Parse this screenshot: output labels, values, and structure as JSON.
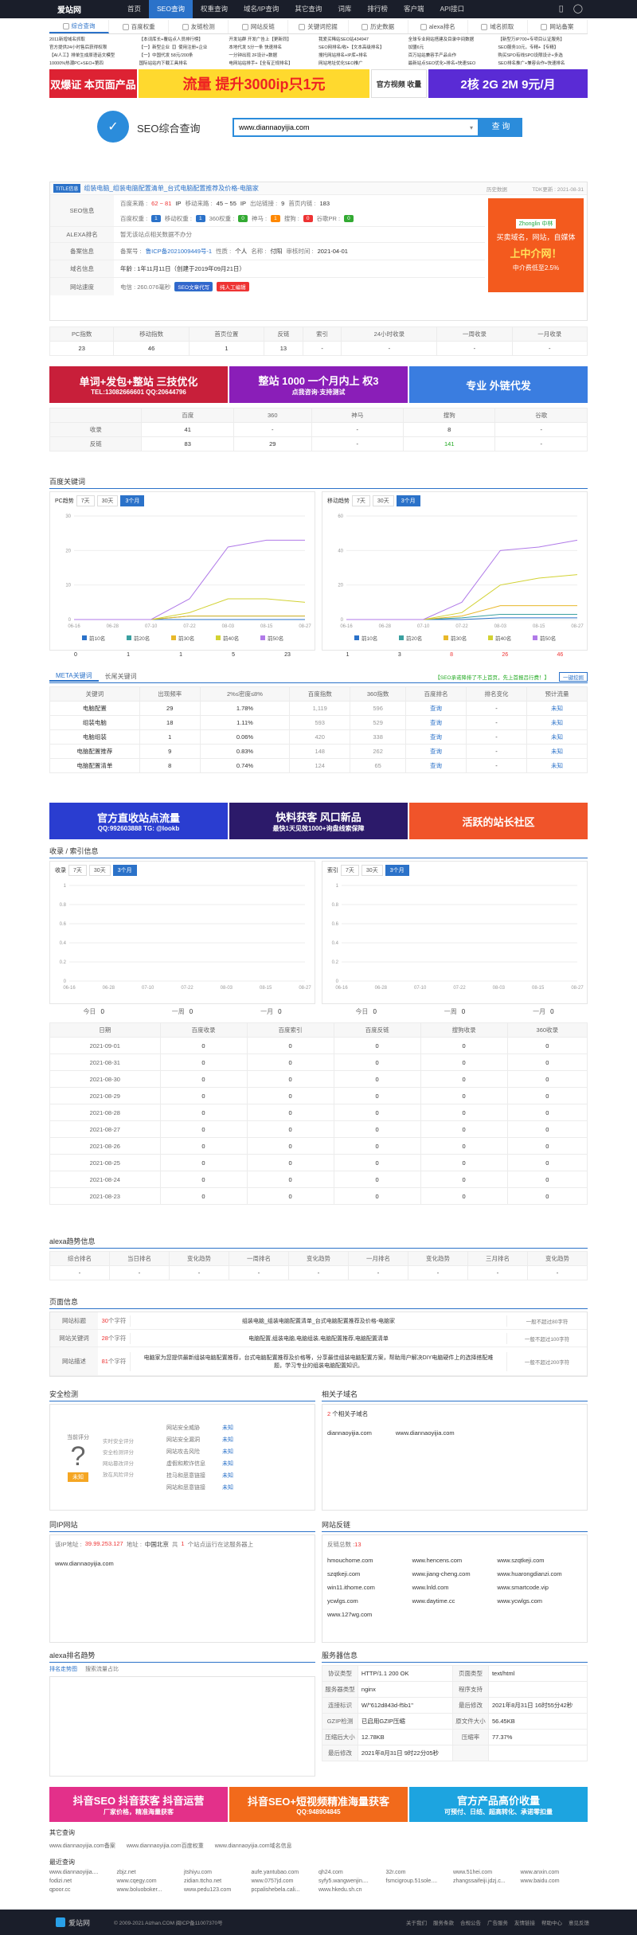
{
  "top": {
    "logo": "爱站网",
    "nav": [
      "首页",
      "SEO查询",
      "权重查询",
      "域名/IP查询",
      "其它查询",
      "词库",
      "排行榜",
      "客户端",
      "API接口"
    ],
    "active": 1
  },
  "tools": [
    "综合查询",
    "百度权重",
    "友链检测",
    "网站反链",
    "关键词挖掘",
    "历史数据",
    "alexa排名",
    "域名抓取",
    "网站备案"
  ],
  "textlinks": [
    "2011新增域名抓取",
    "【本词库长+覆站点人员排行榜】",
    "开发站群 开发广告上【更新同】",
    "我爱买稀站SEO站434947",
    "全球专业网站搭建及目录中间数据",
    "【新型万IP700+专项目认证服务】",
    "官方提供24小时售后获得权限",
    "【一】新型企业【】使用注册+企业",
    "本地代发 5分一条 快速排名",
    "SEO网排名/收+【文本高级排名】",
    "加盟6元",
    "SEO服务10元，专精+【专精】",
    "【AI人工】排单生成原语话文模型",
    "【一】中国代发 58元/200条",
    "一分钟出现 2F设计+数据",
    "搜托网站排名+IP库+排名",
    "百万站站兼容手产品合作",
    "购买SPO有线SPO设限设计+多选",
    "10000%热潮PC+SEO+第四",
    "国际站站内下载工具排名",
    "电网站站排手+【全有正规排名】",
    "网站地址优化SEO推广",
    "最新站点SEO优化+排名+快速SEO",
    "SEO排名推广+兼容合作+快速排名"
  ],
  "search": {
    "title": "SEO综合查询",
    "value": "www.diannaoyijia.com",
    "button": "查 询"
  },
  "overview": {
    "tag": "TITLE信息",
    "title": "组装电脑_组装电脑配置清单_台式电脑配置推荐及价格-电脑家",
    "monitor": "历史数据",
    "tdk": "TDK更新 : 2021-08-31",
    "seo_label": "SEO信息",
    "baidu_label": "百度来路 :",
    "baidu_val": "62 ~ 81",
    "baidu_unit": "IP",
    "mobile_label": "移动来路 :",
    "mobile_val": "45 ~ 55",
    "mobile_unit": "IP",
    "outlinks_label": "出站链接 :",
    "outlinks_val": "9",
    "home_label": "首页内链 :",
    "home_val": "183",
    "weights": [
      {
        "label": "百度权重 :",
        "val": "1"
      },
      {
        "label": "移动权重 :",
        "val": "1"
      },
      {
        "label": "360权重 :",
        "val": "0"
      },
      {
        "label": "神马 :",
        "val": "1"
      },
      {
        "label": "搜狗 :",
        "val": "0"
      },
      {
        "label": "谷歌PR :",
        "val": "0"
      }
    ],
    "alexa_label": "ALEXA排名",
    "alexa_val": "暂无该站点相关数据不办分",
    "beian_label": "备案信息",
    "beian_no_label": "备案号 :",
    "beian_no": "鲁ICP备2021009449号-1",
    "nature_label": "性质 :",
    "nature": "个人",
    "name_label": "名称 :",
    "name": "付阳",
    "date_label": "审核时间 :",
    "date": "2021-04-01",
    "domain_label": "域名信息",
    "age": "年龄 : 1年11月11日（创建于2019年09月21日）",
    "speed_label": "网站速度",
    "speed": "电信 : 260.076毫秒",
    "speed_tag1": "SEO文章代写",
    "speed_tag2": "纯人工编辑",
    "ad_brand": "Zhonglin 中林",
    "ad_text1": "买卖域名，网站，自媒体",
    "ad_text2": "上中介网！",
    "ad_text3": "中介费低至2.5%"
  },
  "stats": {
    "headers": [
      "PC指数",
      "移动指数",
      "首页位置",
      "反链",
      "索引",
      "24小时收录",
      "一周收录",
      "一月收录"
    ],
    "values": [
      "23",
      "46",
      "1",
      "13",
      "-",
      "-",
      "-",
      "-"
    ]
  },
  "banners2": [
    {
      "t1": "单词+发包+整站 三技优化",
      "t2": "TEL:13082666601 QQ:20644796"
    },
    {
      "t1": "整站 1000 一个月内上 权3",
      "t2": "点我咨询·支持测试"
    },
    {
      "t1": "专业 外链代发",
      "t2": ""
    }
  ],
  "engines": {
    "headers": [
      "",
      "百度",
      "360",
      "神马",
      "搜狗",
      "谷歌"
    ],
    "rows": [
      {
        "k": "收录",
        "v": [
          "41",
          "-",
          "-",
          "8",
          "-"
        ]
      },
      {
        "k": "反链",
        "v": [
          "83",
          "29",
          "-",
          "141",
          "-"
        ]
      }
    ]
  },
  "kwtrend": {
    "title": "百度关键词",
    "pc": "PC趋势",
    "mobile": "移动趋势",
    "tabs": [
      "7天",
      "30天",
      "3个月"
    ],
    "xlabels": [
      "06-16",
      "06-28",
      "07-10",
      "07-22",
      "08-03",
      "08-15",
      "08-27"
    ],
    "pc_ticks": [
      "0",
      "10",
      "20",
      "30"
    ],
    "mb_ticks": [
      "0",
      "20",
      "40",
      "60"
    ],
    "legend": [
      "前10名",
      "前20名",
      "前30名",
      "前40名",
      "前50名"
    ],
    "pc_counts": [
      "0",
      "1",
      "1",
      "5",
      "23"
    ],
    "mb_counts": [
      "1",
      "3",
      "8",
      "26",
      "46"
    ]
  },
  "chart_data": [
    {
      "type": "line",
      "title": "PC趋势",
      "ylim": [
        0,
        30
      ],
      "x": [
        "06-16",
        "06-28",
        "07-10",
        "07-22",
        "08-03",
        "08-15",
        "08-27"
      ],
      "series": [
        {
          "name": "前10名",
          "values": [
            0,
            0,
            0,
            0,
            0,
            0,
            0
          ]
        },
        {
          "name": "前20名",
          "values": [
            0,
            0,
            0,
            1,
            1,
            1,
            1
          ]
        },
        {
          "name": "前30名",
          "values": [
            0,
            0,
            0,
            1,
            1,
            1,
            1
          ]
        },
        {
          "name": "前40名",
          "values": [
            0,
            0,
            0,
            2,
            6,
            6,
            5
          ]
        },
        {
          "name": "前50名",
          "values": [
            0,
            0,
            0,
            6,
            21,
            23,
            23
          ]
        }
      ]
    },
    {
      "type": "line",
      "title": "移动趋势",
      "ylim": [
        0,
        60
      ],
      "x": [
        "06-16",
        "06-28",
        "07-10",
        "07-22",
        "08-03",
        "08-15",
        "08-27"
      ],
      "series": [
        {
          "name": "前10名",
          "values": [
            0,
            0,
            0,
            0,
            1,
            1,
            1
          ]
        },
        {
          "name": "前20名",
          "values": [
            0,
            0,
            0,
            1,
            3,
            3,
            3
          ]
        },
        {
          "name": "前30名",
          "values": [
            0,
            0,
            0,
            2,
            8,
            8,
            8
          ]
        },
        {
          "name": "前40名",
          "values": [
            0,
            0,
            0,
            4,
            20,
            24,
            26
          ]
        },
        {
          "name": "前50名",
          "values": [
            0,
            0,
            0,
            10,
            40,
            42,
            46
          ]
        }
      ]
    }
  ],
  "meta": {
    "tab1": "META关键词",
    "tab2": "长尾关键词",
    "note": "【SEO承诺降排了不上首页，先上首报吕行费！】",
    "btn": "一键挖掘",
    "headers": [
      "关键词",
      "出现频率",
      "2%≤密度≤8%",
      "百度指数",
      "360指数",
      "百度排名",
      "排名变化",
      "预计流量"
    ],
    "rows": [
      {
        "kw": "电脑配置",
        "f": "29",
        "d": "1.78%",
        "b": "1,119",
        "s": "596",
        "r": "查询",
        "c": "-",
        "t": "未知"
      },
      {
        "kw": "组装电脑",
        "f": "18",
        "d": "1.11%",
        "b": "593",
        "s": "529",
        "r": "查询",
        "c": "-",
        "t": "未知"
      },
      {
        "kw": "电脑组装",
        "f": "1",
        "d": "0.06%",
        "b": "420",
        "s": "338",
        "r": "查询",
        "c": "-",
        "t": "未知"
      },
      {
        "kw": "电脑配置推荐",
        "f": "9",
        "d": "0.83%",
        "b": "148",
        "s": "262",
        "r": "查询",
        "c": "-",
        "t": "未知"
      },
      {
        "kw": "电脑配置清单",
        "f": "8",
        "d": "0.74%",
        "b": "124",
        "s": "65",
        "r": "查询",
        "c": "-",
        "t": "未知"
      }
    ]
  },
  "banners3": [
    {
      "t1": "官方直收站点流量",
      "t2": "QQ:992603888 TG: @lookb"
    },
    {
      "t1": "快料获客 风口新品",
      "t2": "最快1天见效1000+询盘线索保障"
    },
    {
      "t1": "活跃的站长社区",
      "t2": ""
    }
  ],
  "index": {
    "title": "收录 / 索引信息",
    "left": "收录",
    "right": "索引",
    "tabs": [
      "7天",
      "30天",
      "3个月"
    ],
    "ticks": [
      "0",
      "0.2",
      "0.4",
      "0.6",
      "0.8",
      "1"
    ],
    "xlabels": [
      "06-16",
      "06-28",
      "07-10",
      "07-22",
      "08-03",
      "08-15",
      "08-27"
    ],
    "counts_left": [
      {
        "k": "今日",
        "v": "0"
      },
      {
        "k": "一周",
        "v": "0"
      },
      {
        "k": "一月",
        "v": "0"
      }
    ],
    "counts_right": [
      {
        "k": "今日",
        "v": "0"
      },
      {
        "k": "一周",
        "v": "0"
      },
      {
        "k": "一月",
        "v": "0"
      }
    ]
  },
  "history": {
    "headers": [
      "日期",
      "百度收录",
      "百度索引",
      "百度反链",
      "搜狗收录",
      "360收录"
    ],
    "rows": [
      [
        "2021-09-01",
        "0",
        "0",
        "0",
        "0",
        "0"
      ],
      [
        "2021-08-31",
        "0",
        "0",
        "0",
        "0",
        "0"
      ],
      [
        "2021-08-30",
        "0",
        "0",
        "0",
        "0",
        "0"
      ],
      [
        "2021-08-29",
        "0",
        "0",
        "0",
        "0",
        "0"
      ],
      [
        "2021-08-28",
        "0",
        "0",
        "0",
        "0",
        "0"
      ],
      [
        "2021-08-27",
        "0",
        "0",
        "0",
        "0",
        "0"
      ],
      [
        "2021-08-26",
        "0",
        "0",
        "0",
        "0",
        "0"
      ],
      [
        "2021-08-25",
        "0",
        "0",
        "0",
        "0",
        "0"
      ],
      [
        "2021-08-24",
        "0",
        "0",
        "0",
        "0",
        "0"
      ],
      [
        "2021-08-23",
        "0",
        "0",
        "0",
        "0",
        "0"
      ]
    ]
  },
  "alexa": {
    "title": "alexa趋势信息",
    "headers": [
      "综合排名",
      "当日排名",
      "变化趋势",
      "一周排名",
      "变化趋势",
      "一月排名",
      "变化趋势",
      "三月排名",
      "变化趋势"
    ],
    "values": [
      "-",
      "-",
      "-",
      "-",
      "-",
      "-",
      "-",
      "-",
      "-"
    ]
  },
  "pageinfo": {
    "title": "页面信息",
    "rows": [
      {
        "k": "网站标题",
        "n": "30",
        "u": "个字符",
        "v": "组装电脑_组装电脑配置清单_台式电脑配置推荐及价格-电脑家",
        "h": "一般不超过80字符"
      },
      {
        "k": "网站关键词",
        "n": "28",
        "u": "个字符",
        "v": "电脑配置,组装电脑,电脑组装,电脑配置推荐,电脑配置清单",
        "h": "一般不超过100字符"
      },
      {
        "k": "网站描述",
        "n": "81",
        "u": "个字符",
        "v": "电脑家为您提供最新组装电脑配置推荐，台式电脑配置推荐及价格等，分享最佳组装电脑配置方案，帮助用户解决DIY电脑硬件上的选择搭配难题，学习专业的组装电脑配置知识。",
        "h": "一般不超过200字符"
      }
    ]
  },
  "security": {
    "title": "安全检测",
    "score_label": "当前评分",
    "score": "?",
    "btn": "未知",
    "items": [
      "实时安全评分",
      "安全检测评分",
      "网站篡改评分",
      "放在风险评分"
    ],
    "checks": [
      {
        "k": "网站安全威胁",
        "v": "未知"
      },
      {
        "k": "网站安全漏洞",
        "v": "未知"
      },
      {
        "k": "网站攻击风险",
        "v": "未知"
      },
      {
        "k": "虚假和欺诈信息",
        "v": "未知"
      },
      {
        "k": "挂马和恶意链接",
        "v": "未知"
      },
      {
        "k": "网站和恶意链接",
        "v": "未知"
      }
    ]
  },
  "subdomain": {
    "title": "相关子域名",
    "count": "2",
    "text": "个相关子域名",
    "items": [
      "diannaoyijia.com",
      "www.diannaoyijia.com"
    ]
  },
  "sameip": {
    "title": "同IP网站",
    "ip_label": "该IP地址 :",
    "ip": "39.99.253.127",
    "loc_label": "地址 :",
    "loc": "中国北京",
    "note_pre": "共",
    "note_num": "1",
    "note_post": "个站点运行在这服务器上",
    "items": [
      "www.diannaoyijia.com"
    ]
  },
  "backlinks": {
    "title": "网站反链",
    "count_label": "反链总数 :",
    "count": "13",
    "items": [
      "hmouchome.com",
      "www.hencens.com",
      "www.szqtkeji.com",
      "szqtkeji.com",
      "www.jiang-cheng.com",
      "www.huarongdianzi.com",
      "win11.ithome.com",
      "www.lnld.com",
      "www.smartcode.vip",
      "ycwlgs.com",
      "www.daytime.cc",
      "www.ycwlgs.com",
      "www.127wg.com"
    ]
  },
  "alexarank": {
    "title": "alexa排名趋势",
    "link1": "排名走势图",
    "link2": "搜索流量占比"
  },
  "server": {
    "title": "服务器信息",
    "rows": [
      [
        "协议类型",
        "HTTP/1.1 200 OK",
        "页面类型",
        "text/html"
      ],
      [
        "服务器类型",
        "nginx",
        "程序支持",
        ""
      ],
      [
        "连接标识",
        "W/\"612d843d-f5b1\"",
        "最后修改",
        "2021年8月31日 16时55分42秒"
      ],
      [
        "GZIP检测",
        "已启用GZIP压缩",
        "原文件大小",
        "56.45KB"
      ],
      [
        "压缩后大小",
        "12.78KB",
        "压缩率",
        "77.37%"
      ],
      [
        "最后修改",
        "2021年8月31日 9时22分05秒",
        "",
        ""
      ]
    ]
  },
  "banners4": [
    {
      "t1": "抖音SEO 抖音获客 抖音运营",
      "t2": "厂家价格，精准海量获客"
    },
    {
      "t1": "抖音SEO+短视频精准海量获客",
      "t2": "QQ:948904845"
    },
    {
      "t1": "官方产品高价收量",
      "t2": "可预付、日结、超高转化、承诺零扣量"
    }
  ],
  "other": {
    "title1": "其它查询",
    "links1": [
      "www.diannaoyijia.com备案",
      "www.diannaoyijia.com百度权重",
      "www.diannaoyijia.com域名信息"
    ],
    "title2": "最近查询",
    "links2": [
      "www.diannaoyijia....",
      "zbjz.net",
      "jtshiyu.com",
      "aufe.yantubao.com",
      "qh24.com",
      "32r.com",
      "www.51hei.com",
      "www.anxin.com",
      "fodizi.net",
      "www.cqegy.com",
      "zidian.ttcho.net",
      "www.0757jd.com",
      "syfy5.wangwenjin....",
      "fsmcigroup.51sole....",
      "zhangssaifeiji.jdzj.c...",
      "www.baidu.com",
      "qpoor.cc",
      "www.boluoboker...",
      "www.pedu123.com",
      "pcpalishebela.cali...",
      "www.hkedu.sh.cn",
      "",
      "",
      ""
    ]
  },
  "footer": {
    "logo": "爱站网",
    "copy": "© 2009-2021  Aizhan.COM  闽ICP备11007370号",
    "links": [
      "关于我们",
      "服务条款",
      "合规公告",
      "广告服务",
      "友情链接",
      "帮助中心",
      "意见反馈"
    ]
  }
}
